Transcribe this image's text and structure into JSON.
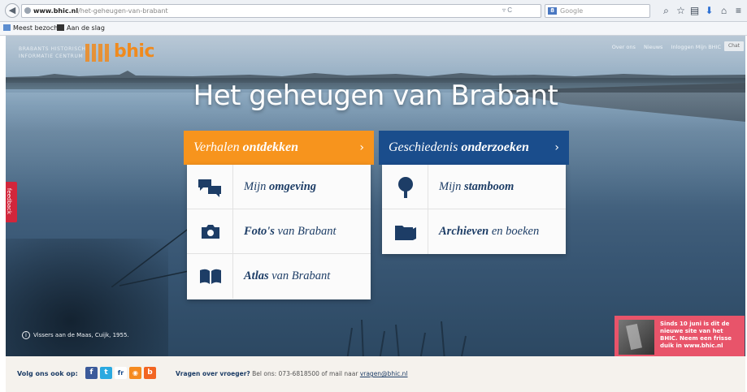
{
  "browser": {
    "url_domain": "www.bhic.nl",
    "url_path": "/het-geheugen-van-brabant",
    "url_controls": "▿ C",
    "search_placeholder": "Google",
    "search_engine_badge": "8",
    "bookmarks": [
      {
        "label": "Meest bezocht",
        "icon": "bookmark-folder-icon"
      },
      {
        "label": "Aan de slag",
        "icon": "bookmark-icon"
      }
    ]
  },
  "site": {
    "logo_line1": "BRABANTS HISTORISCH",
    "logo_line2": "INFORMATIE CENTRUM",
    "logo_mark": "bhic",
    "brand_color": "#f08a1d",
    "nav": [
      "Over ons",
      "Nieuws",
      "Inloggen Mijn BHIC"
    ],
    "chat_label": "Chat",
    "hero_title": "Het geheugen van Brabant",
    "feedback_label": "feedback"
  },
  "panels": {
    "left": {
      "header_normal": "Verhalen",
      "header_bold": "ontdekken",
      "chevron": "›",
      "color": "#f7941d",
      "items": [
        {
          "bold_first": false,
          "normal": "Mijn",
          "bold": "omgeving",
          "icon": "speech-bubbles-icon"
        },
        {
          "bold_first": true,
          "bold": "Foto's",
          "normal": "van Brabant",
          "icon": "camera-icon"
        },
        {
          "bold_first": true,
          "bold": "Atlas",
          "normal": "van Brabant",
          "icon": "book-icon"
        }
      ]
    },
    "right": {
      "header_normal": "Geschiedenis",
      "header_bold": "onderzoeken",
      "chevron": "›",
      "color": "#1a4d8c",
      "items": [
        {
          "bold_first": false,
          "normal": "Mijn",
          "bold": "stamboom",
          "icon": "tree-icon"
        },
        {
          "bold_first": true,
          "bold": "Archieven",
          "normal": "en boeken",
          "icon": "folder-icon"
        }
      ]
    }
  },
  "caption": {
    "info_glyph": "i",
    "text": "Vissers aan de Maas, Cuijk, 1955."
  },
  "promo": {
    "text": "Sinds 10 juni is dit de nieuwe site van het BHIC. Neem een frisse duik in www.bhic.nl",
    "color": "#e8546a"
  },
  "footer": {
    "follow_label": "Volg ons ook op:",
    "social": [
      {
        "glyph": "f",
        "name": "facebook-icon",
        "color": "#3b5a9a"
      },
      {
        "glyph": "t",
        "name": "twitter-icon",
        "color": "#2aa9e0"
      },
      {
        "glyph": "fr",
        "name": "flickr-icon",
        "color": "#ffffff"
      },
      {
        "glyph": "◉",
        "name": "rss-icon",
        "color": "#f58a1f"
      },
      {
        "glyph": "b",
        "name": "blog-icon",
        "color": "#f26522"
      }
    ],
    "questions_bold": "Vragen over vroeger?",
    "questions_text": " Bel ons: 073-6818500 of mail naar ",
    "questions_email": "vragen@bhic.nl"
  }
}
